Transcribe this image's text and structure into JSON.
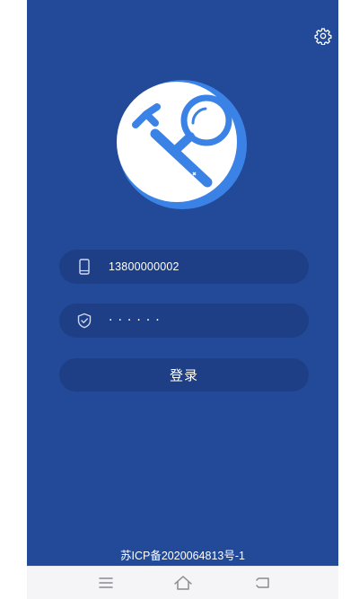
{
  "login": {
    "phone_value": "13800000002",
    "password_mask": "······",
    "submit_label": "登录"
  },
  "footer": {
    "icp_text": "苏ICP备2020064813号-1"
  },
  "icons": {
    "settings": "gear-icon",
    "logo": "wrench-magnifier-icon",
    "phone": "phone-icon",
    "password": "shield-check-icon",
    "nav_menu": "menu-icon",
    "nav_home": "home-icon",
    "nav_back": "back-icon"
  },
  "colors": {
    "background": "#224a98",
    "field": "#1e3f86",
    "logo_accent": "#3b82e6",
    "text": "#ffffff"
  }
}
